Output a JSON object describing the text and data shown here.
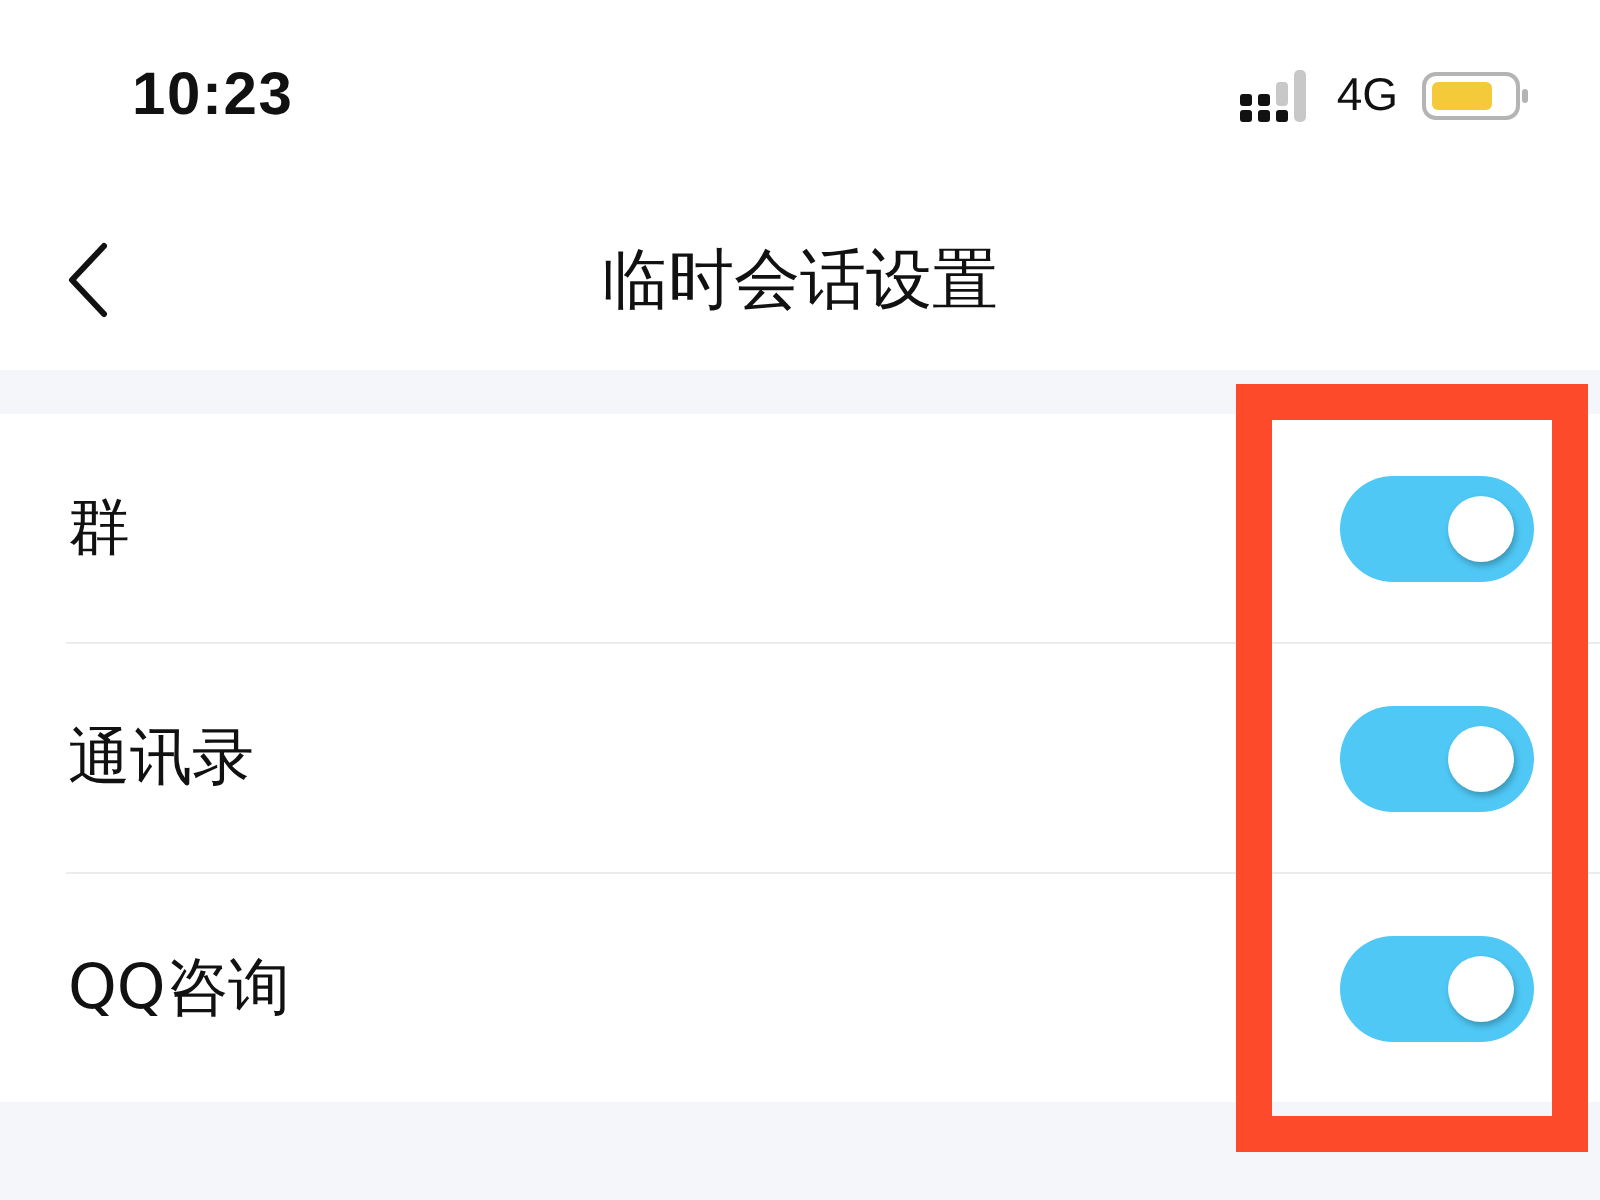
{
  "status_bar": {
    "time": "10:23",
    "network": "4G"
  },
  "nav_bar": {
    "title": "临时会话设置"
  },
  "settings": [
    {
      "label": "群",
      "on": true
    },
    {
      "label": "通讯录",
      "on": true
    },
    {
      "label": "QQ咨询",
      "on": true
    }
  ],
  "annotation": {
    "kind": "rectangle"
  }
}
